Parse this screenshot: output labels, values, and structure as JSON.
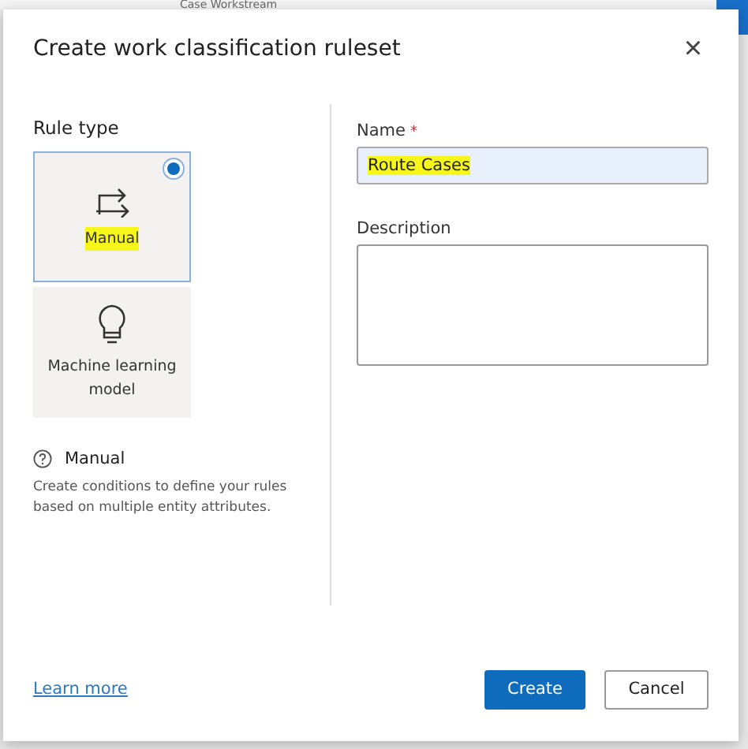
{
  "background": {
    "text": "Case Workstream"
  },
  "dialog": {
    "title": "Create work classification ruleset",
    "close": "×"
  },
  "rule_type": {
    "label": "Rule type",
    "options": [
      {
        "kind": "manual",
        "label": "Manual",
        "selected": true,
        "highlighted": true
      },
      {
        "kind": "ml",
        "label": "Machine learning model",
        "selected": false,
        "highlighted": false
      }
    ]
  },
  "help": {
    "title": "Manual",
    "text": "Create conditions to define your rules based on multiple entity attributes."
  },
  "fields": [
    {
      "kind": "input",
      "label": "Name",
      "required_mark": "*",
      "value": "Route Cases",
      "highlighted": true
    },
    {
      "kind": "textarea",
      "label": "Description"
    }
  ],
  "footer": {
    "link": "Learn more",
    "buttons": [
      {
        "label": "Create",
        "primary": true
      },
      {
        "label": "Cancel",
        "primary": false
      }
    ]
  }
}
